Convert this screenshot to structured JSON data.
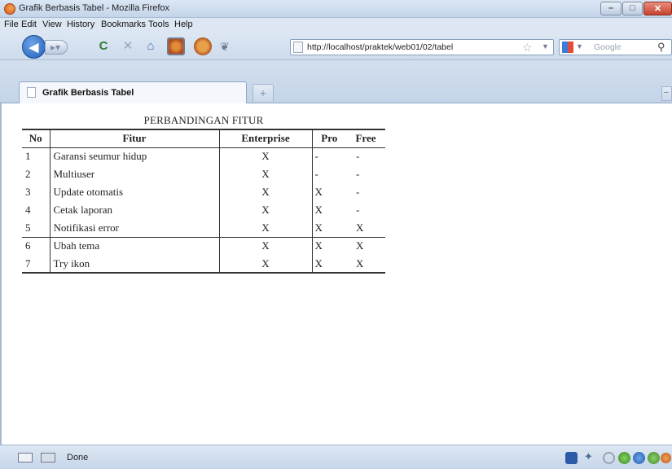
{
  "window": {
    "title": "Grafik Berbasis Tabel - Mozilla Firefox",
    "buttons": {
      "minimize": "–",
      "maximize": "□",
      "close": "✕"
    }
  },
  "menu": {
    "items": [
      "File",
      "Edit",
      "View",
      "History",
      "Bookmarks",
      "Tools",
      "Help"
    ]
  },
  "toolbar": {
    "back_icon": "back-arrow-icon",
    "reload": "C",
    "stop": "✕",
    "home": "⌂",
    "url": "http://localhost/praktek/web01/02/tabel",
    "search_placeholder": "Google"
  },
  "tabs": [
    {
      "label": "Grafik Berbasis Tabel",
      "active": true
    }
  ],
  "newtab_label": "+",
  "table": {
    "caption": "PERBANDINGAN FITUR",
    "headers": [
      "No",
      "Fitur",
      "Enterprise",
      "Pro",
      "Free"
    ],
    "rows": [
      [
        "1",
        "Garansi seumur hidup",
        "X",
        "-",
        "-"
      ],
      [
        "2",
        "Multiuser",
        "X",
        "-",
        "-"
      ],
      [
        "3",
        "Update otomatis",
        "X",
        "X",
        "-"
      ],
      [
        "4",
        "Cetak laporan",
        "X",
        "X",
        "-"
      ],
      [
        "5",
        "Notifikasi error",
        "X",
        "X",
        "X"
      ],
      [
        "6",
        "Ubah tema",
        "X",
        "X",
        "X"
      ],
      [
        "7",
        "Try ikon",
        "X",
        "X",
        "X"
      ]
    ]
  },
  "status": {
    "text": "Done"
  },
  "colors": {
    "titlebar": "#c4d5ea",
    "close": "#c5432e",
    "content_bg": "#ffffff"
  }
}
